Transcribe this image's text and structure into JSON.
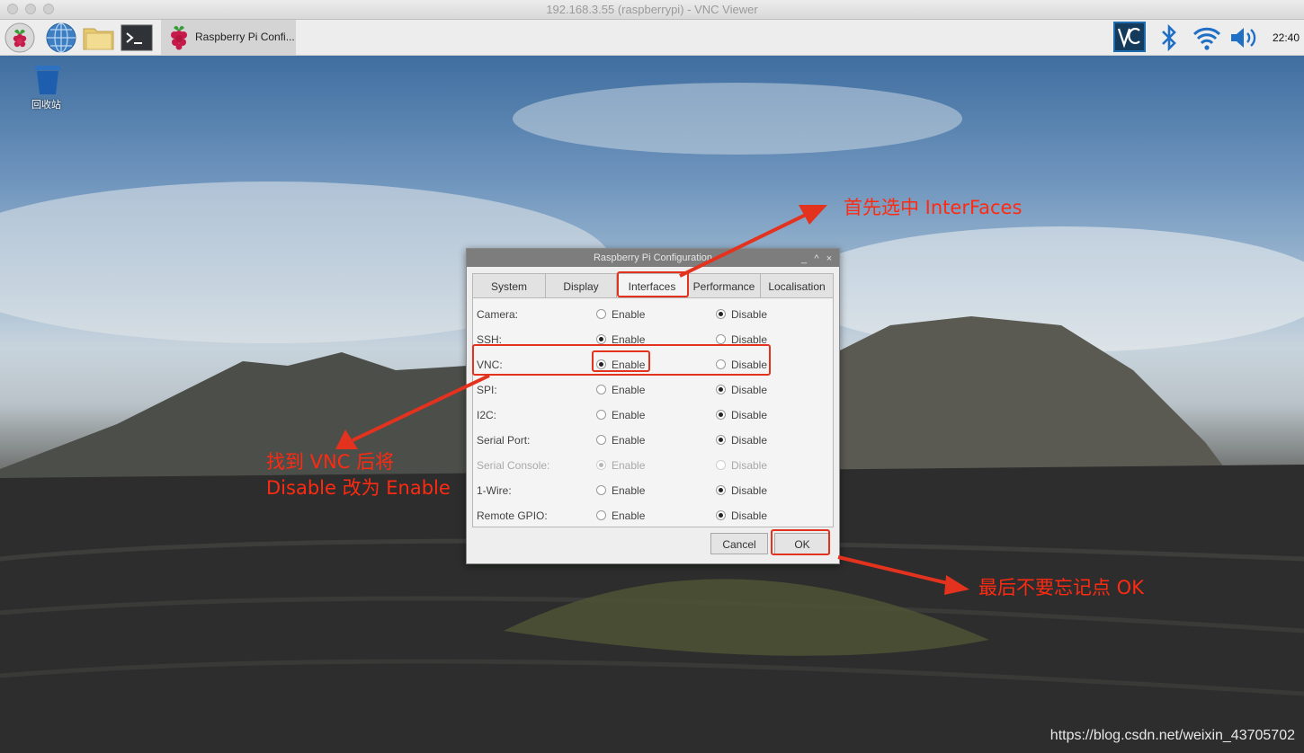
{
  "window": {
    "title": "192.168.3.55 (raspberrypi) - VNC Viewer"
  },
  "taskbar": {
    "launchers": [
      "raspberry-menu-icon",
      "web-browser-icon",
      "file-manager-icon",
      "terminal-icon"
    ],
    "task_label": "Raspberry Pi Confi...",
    "tray": [
      "vnc-icon",
      "bluetooth-icon",
      "wifi-icon",
      "volume-icon"
    ],
    "clock": "22:40"
  },
  "desktop": {
    "trash_label": "回收站",
    "watermark": "https://blog.csdn.net/weixin_43705702"
  },
  "dialog": {
    "title": "Raspberry Pi Configuration",
    "controls": [
      "_",
      "^",
      "×"
    ],
    "tabs": [
      "System",
      "Display",
      "Interfaces",
      "Performance",
      "Localisation"
    ],
    "active_tab": "Interfaces",
    "enable_label": "Enable",
    "disable_label": "Disable",
    "rows": [
      {
        "label": "Camera:",
        "selected": "Disable",
        "enabled": true
      },
      {
        "label": "SSH:",
        "selected": "Enable",
        "enabled": true
      },
      {
        "label": "VNC:",
        "selected": "Enable",
        "enabled": true
      },
      {
        "label": "SPI:",
        "selected": "Disable",
        "enabled": true
      },
      {
        "label": "I2C:",
        "selected": "Disable",
        "enabled": true
      },
      {
        "label": "Serial Port:",
        "selected": "Disable",
        "enabled": true
      },
      {
        "label": "Serial Console:",
        "selected": "Enable",
        "enabled": false
      },
      {
        "label": "1-Wire:",
        "selected": "Disable",
        "enabled": true
      },
      {
        "label": "Remote GPIO:",
        "selected": "Disable",
        "enabled": true
      }
    ],
    "cancel_label": "Cancel",
    "ok_label": "OK"
  },
  "annotations": {
    "interfaces_note": "首先选中 InterFaces",
    "vnc_note_line1": "找到 VNC 后将",
    "vnc_note_line2": "Disable 改为 Enable",
    "ok_note": "最后不要忘记点 OK",
    "color": "#ff2a12"
  }
}
